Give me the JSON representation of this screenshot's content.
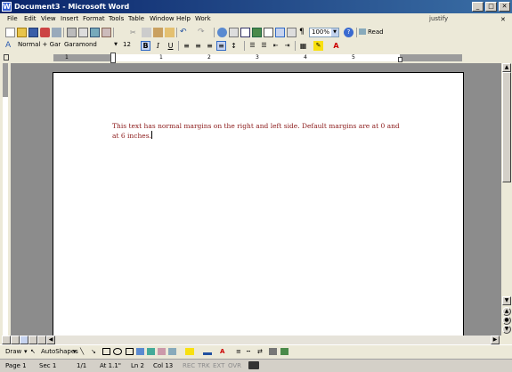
{
  "window": {
    "title": "Document3 - Microsoft Word",
    "app_icon": "W"
  },
  "menu": [
    "File",
    "Edit",
    "View",
    "Insert",
    "Format",
    "Tools",
    "Table",
    "Window",
    "Help",
    "Work"
  ],
  "help_box": {
    "value": "justify"
  },
  "standard_toolbar": {
    "zoom": "100%",
    "read_label": "Read"
  },
  "formatting_toolbar": {
    "style": "Normal + Garar",
    "font": "Garamond",
    "size": "12",
    "bold": "B",
    "italic": "I",
    "underline": "U"
  },
  "ruler": {
    "numbers": [
      "1",
      "1",
      "2",
      "3",
      "4",
      "5"
    ]
  },
  "document": {
    "text": "This text has normal margins on the right and left side. Default margins are at 0 and at 6 inches.",
    "text_color": "#8b1a1a"
  },
  "drawing_toolbar": {
    "draw_label": "Draw",
    "autoshapes_label": "AutoShapes"
  },
  "status": {
    "page": "Page 1",
    "sec": "Sec 1",
    "page_of": "1/1",
    "at": "At 1.1\"",
    "ln": "Ln 2",
    "col": "Col 13",
    "rec": "REC",
    "trk": "TRK",
    "ext": "EXT",
    "ovr": "OVR"
  },
  "icons": [
    "new-icon",
    "open-icon",
    "save-icon",
    "permission-icon",
    "email-icon",
    "print-icon",
    "print-preview-icon",
    "spelling-icon",
    "research-icon",
    "cut-icon",
    "copy-icon",
    "paste-icon",
    "format-painter-icon",
    "undo-icon",
    "redo-icon",
    "hyperlink-icon",
    "tables-borders-icon",
    "insert-table-icon",
    "insert-excel-icon",
    "columns-icon",
    "drawing-icon",
    "document-map-icon",
    "show-hide-icon",
    "help-icon",
    "read-icon"
  ]
}
